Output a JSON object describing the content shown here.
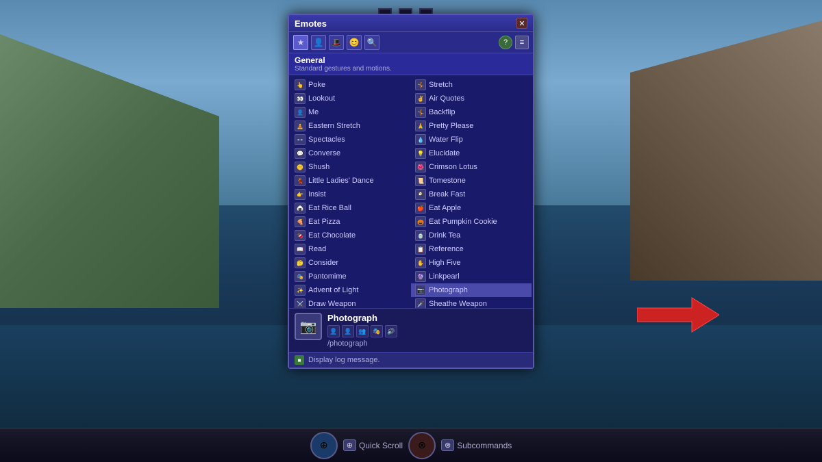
{
  "background": {
    "description": "FFXIV game background with castle and water"
  },
  "panel": {
    "title": "Emotes",
    "close_label": "✕",
    "tabs": [
      {
        "id": "star",
        "icon": "★",
        "label": "Favorites",
        "active": true
      },
      {
        "id": "person",
        "icon": "👤",
        "label": "General",
        "active": false
      },
      {
        "id": "hat",
        "icon": "🎩",
        "label": "Special",
        "active": false
      },
      {
        "id": "face",
        "icon": "😊",
        "label": "Expressions",
        "active": false
      },
      {
        "id": "search",
        "icon": "🔍",
        "label": "Search",
        "active": false
      }
    ],
    "help_label": "?",
    "settings_label": "≡"
  },
  "section": {
    "title": "General",
    "description": "Standard gestures and motions."
  },
  "emotes_left": [
    {
      "name": "Poke",
      "icon": "👆"
    },
    {
      "name": "Lookout",
      "icon": "👀"
    },
    {
      "name": "Me",
      "icon": "👤"
    },
    {
      "name": "Eastern Stretch",
      "icon": "🧘"
    },
    {
      "name": "Spectacles",
      "icon": "👓"
    },
    {
      "name": "Converse",
      "icon": "💬"
    },
    {
      "name": "Shush",
      "icon": "🤫"
    },
    {
      "name": "Little Ladies' Dance",
      "icon": "💃"
    },
    {
      "name": "Insist",
      "icon": "👉"
    },
    {
      "name": "Eat Rice Ball",
      "icon": "🍙"
    },
    {
      "name": "Eat Pizza",
      "icon": "🍕"
    },
    {
      "name": "Eat Chocolate",
      "icon": "🍫"
    },
    {
      "name": "Read",
      "icon": "📖"
    },
    {
      "name": "Consider",
      "icon": "🤔"
    },
    {
      "name": "Pantomime",
      "icon": "🎭"
    },
    {
      "name": "Advent of Light",
      "icon": "✨"
    },
    {
      "name": "Draw Weapon",
      "icon": "⚔️"
    }
  ],
  "emotes_right": [
    {
      "name": "Stretch",
      "icon": "🤸"
    },
    {
      "name": "Air Quotes",
      "icon": "✌️"
    },
    {
      "name": "Backflip",
      "icon": "🤸"
    },
    {
      "name": "Pretty Please",
      "icon": "🙏"
    },
    {
      "name": "Water Flip",
      "icon": "💧"
    },
    {
      "name": "Elucidate",
      "icon": "💡"
    },
    {
      "name": "Crimson Lotus",
      "icon": "🌺"
    },
    {
      "name": "Tomestone",
      "icon": "📜"
    },
    {
      "name": "Break Fast",
      "icon": "🍳"
    },
    {
      "name": "Eat Apple",
      "icon": "🍎"
    },
    {
      "name": "Eat Pumpkin Cookie",
      "icon": "🎃"
    },
    {
      "name": "Drink Tea",
      "icon": "🍵"
    },
    {
      "name": "Reference",
      "icon": "📋"
    },
    {
      "name": "High Five",
      "icon": "✋"
    },
    {
      "name": "Linkpearl",
      "icon": "🔮"
    },
    {
      "name": "Photograph",
      "icon": "📷",
      "selected": true
    },
    {
      "name": "Sheathe Weapon",
      "icon": "🗡️"
    }
  ],
  "detail": {
    "name": "Photograph",
    "icon": "📷",
    "command": "/photograph",
    "sub_icons": [
      "👤",
      "👤",
      "👤",
      "👤",
      "👤"
    ]
  },
  "footer": {
    "icon": "■",
    "text": "Display log message."
  },
  "taskbar": {
    "quick_scroll_label": "Quick Scroll",
    "subcommands_label": "Subcommands",
    "quick_scroll_key": "⊕",
    "subcommands_key": "⊗"
  }
}
